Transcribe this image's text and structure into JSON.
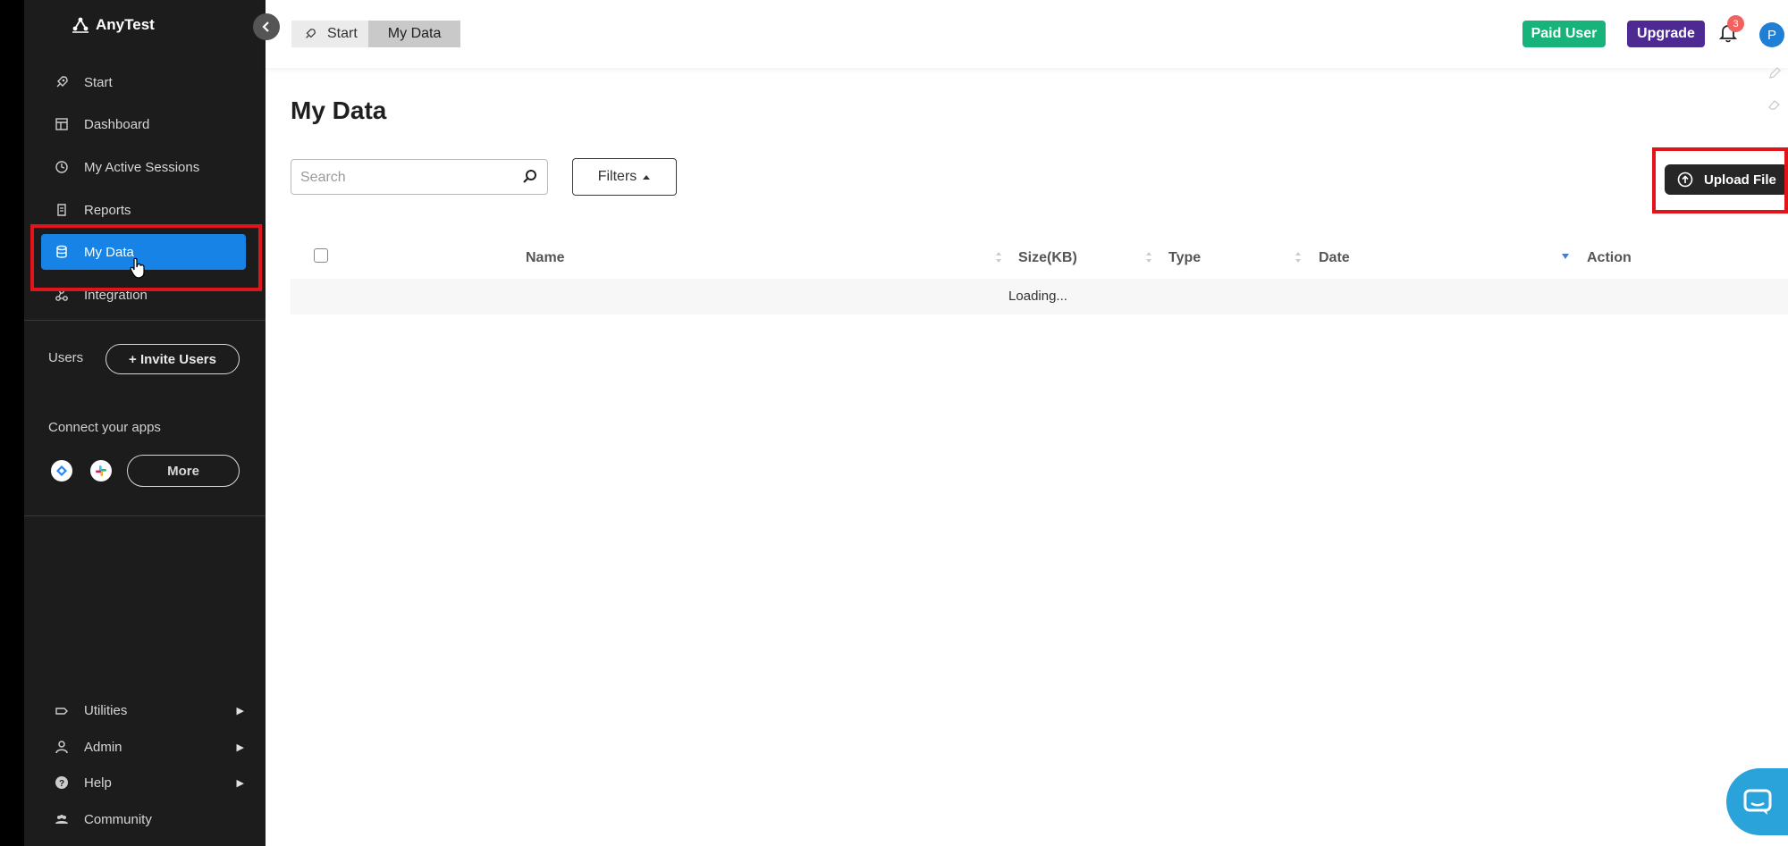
{
  "app": {
    "name": "AnyTest"
  },
  "sidebar": {
    "nav": [
      {
        "label": "Start",
        "icon": "rocket-icon"
      },
      {
        "label": "Dashboard",
        "icon": "dashboard-icon"
      },
      {
        "label": "My Active Sessions",
        "icon": "clock-icon"
      },
      {
        "label": "Reports",
        "icon": "report-icon"
      },
      {
        "label": "My Data",
        "icon": "database-icon",
        "active": true
      },
      {
        "label": "Integration",
        "icon": "integration-icon"
      }
    ],
    "users_label": "Users",
    "invite_label": "+ Invite Users",
    "connect_label": "Connect your apps",
    "connect_apps": [
      "jira-icon",
      "slack-icon"
    ],
    "more_label": "More",
    "bottom": [
      {
        "label": "Utilities",
        "icon": "utilities-icon",
        "expandable": true
      },
      {
        "label": "Admin",
        "icon": "user-icon",
        "expandable": true
      },
      {
        "label": "Help",
        "icon": "help-icon",
        "expandable": true
      },
      {
        "label": "Community",
        "icon": "community-icon",
        "expandable": false
      }
    ]
  },
  "header": {
    "breadcrumb": [
      "Start",
      "My Data"
    ],
    "paid_label": "Paid User",
    "upgrade_label": "Upgrade",
    "notifications_count": "3",
    "avatar_initial": "P"
  },
  "main": {
    "title": "My Data",
    "search_placeholder": "Search",
    "filters_label": "Filters",
    "upload_label": "Upload File",
    "table": {
      "columns": [
        "Name",
        "Size(KB)",
        "Type",
        "Date",
        "Action"
      ],
      "status": "Loading..."
    }
  },
  "colors": {
    "sidebar_bg": "#1c1c1c",
    "active_nav": "#1783e6",
    "paid_badge": "#17b37a",
    "upgrade": "#4d2a91",
    "annotation_red": "#e1141c",
    "chat": "#29a3d9"
  }
}
